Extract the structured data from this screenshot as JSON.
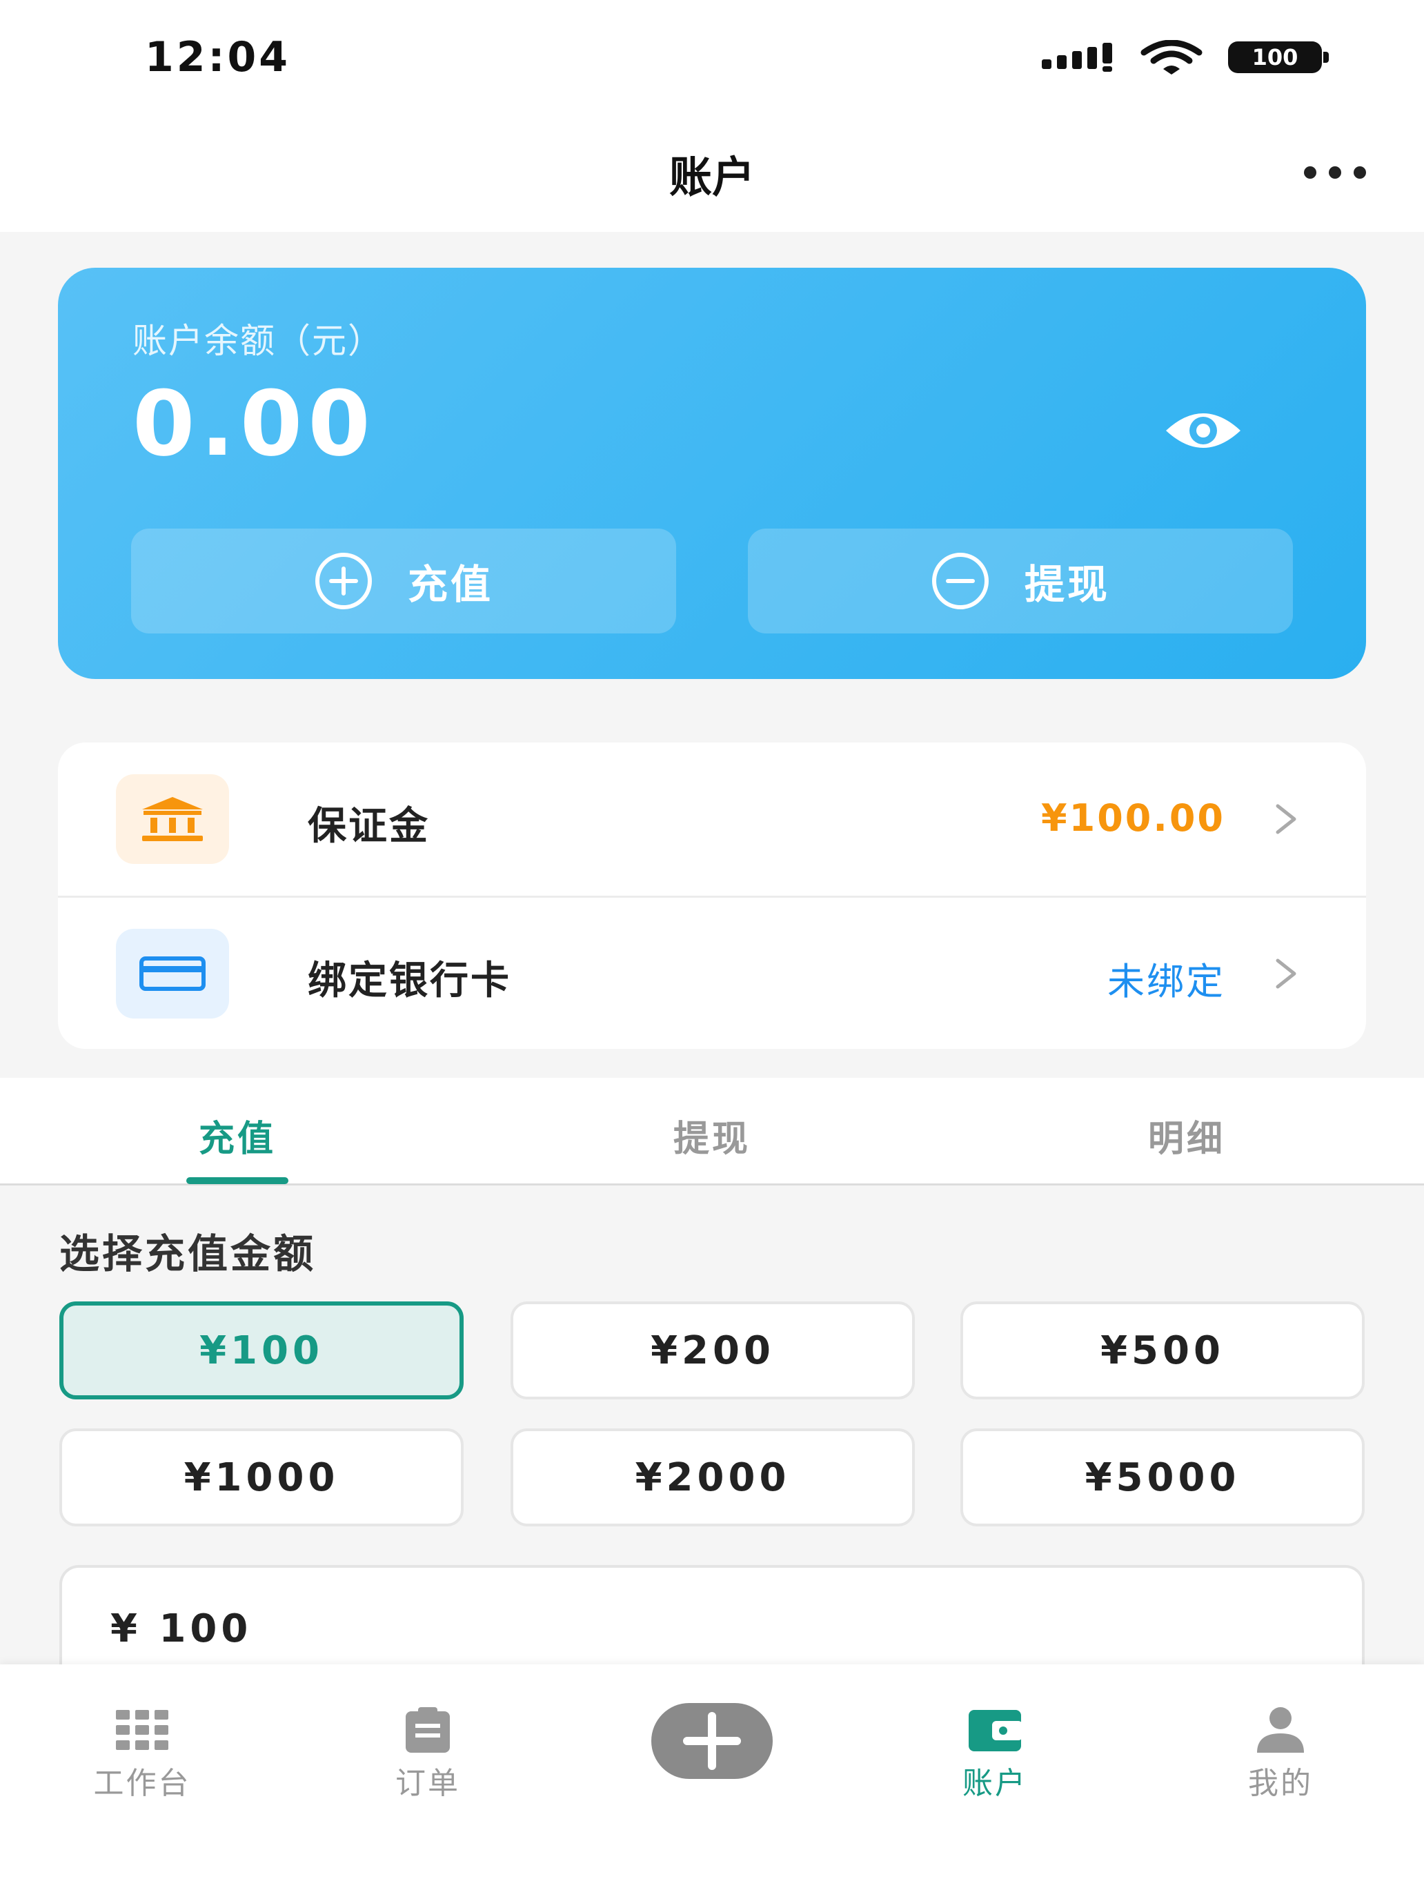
{
  "status_bar": {
    "time": "12:04",
    "battery": "100"
  },
  "header": {
    "title": "账户"
  },
  "balance_card": {
    "label": "账户余额（元）",
    "amount": "0.00",
    "recharge_label": "充值",
    "withdraw_label": "提现"
  },
  "list": {
    "deposit": {
      "title": "保证金",
      "value": "¥100.00"
    },
    "bank_card": {
      "title": "绑定银行卡",
      "value": "未绑定"
    }
  },
  "tabs": [
    {
      "label": "充值"
    },
    {
      "label": "提现"
    },
    {
      "label": "明细"
    }
  ],
  "recharge": {
    "section_title": "选择充值金额",
    "amounts": [
      "¥100",
      "¥200",
      "¥500",
      "¥1000",
      "¥2000",
      "¥5000"
    ],
    "selected": "¥100",
    "input_value": "¥ 100"
  },
  "tabbar": [
    {
      "label": "工作台",
      "icon": "grid-icon"
    },
    {
      "label": "订单",
      "icon": "clipboard-icon"
    },
    {
      "label": "",
      "icon": "plus-icon"
    },
    {
      "label": "账户",
      "icon": "wallet-icon"
    },
    {
      "label": "我的",
      "icon": "user-icon"
    }
  ],
  "colors": {
    "accent": "#179a85",
    "card_blue": "#2aaff0",
    "deposit_orange": "#f7950d",
    "link_blue": "#1e8ff0"
  }
}
